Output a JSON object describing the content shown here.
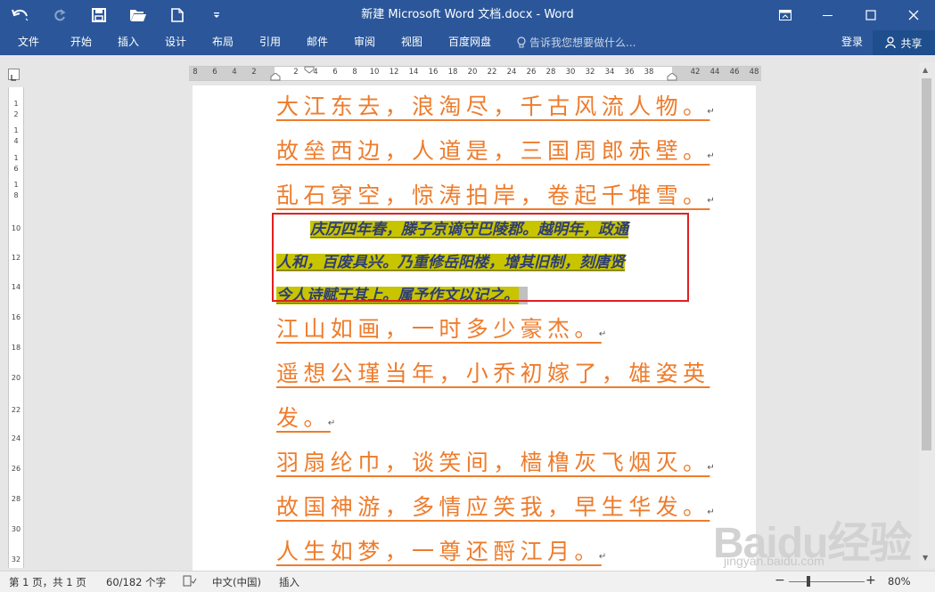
{
  "window": {
    "title": "新建 Microsoft Word 文档.docx - Word"
  },
  "quick_access": {
    "icons": [
      "undo-icon",
      "redo-icon",
      "save-icon",
      "open-icon",
      "new-icon",
      "customize-icon"
    ]
  },
  "ribbon": {
    "tabs": [
      "文件",
      "开始",
      "插入",
      "设计",
      "布局",
      "引用",
      "邮件",
      "审阅",
      "视图",
      "百度网盘"
    ],
    "tell_me": "告诉我您想要做什么...",
    "sign_in": "登录",
    "share": "共享"
  },
  "ruler": {
    "h_numbers": [
      "8",
      "6",
      "4",
      "2",
      "2",
      "4",
      "6",
      "8",
      "10",
      "12",
      "14",
      "16",
      "18",
      "20",
      "22",
      "24",
      "26",
      "28",
      "30",
      "32",
      "34",
      "36",
      "38",
      "42",
      "44",
      "46",
      "48"
    ],
    "v_numbers": [
      "1",
      "2",
      "1",
      "4",
      "1",
      "6",
      "1",
      "8",
      "10",
      "12",
      "14",
      "16",
      "18",
      "20",
      "22",
      "24",
      "26",
      "28",
      "30",
      "32"
    ]
  },
  "document": {
    "lines_before": [
      "大江东去，浪淘尽，千古风流人物。",
      "故垒西边，人道是，三国周郎赤壁。",
      "乱石穿空，惊涛拍岸，卷起千堆雪。"
    ],
    "selected_paragraph": [
      "庆历四年春，滕子京谪守巴陵郡。越明年，政通",
      "人和，百废具兴。乃重修岳阳楼，增其旧制，刻唐贤",
      "今人诗赋于其上。属予作文以记之。"
    ],
    "lines_after": [
      "江山如画，一时多少豪杰。",
      "遥想公瑾当年，小乔初嫁了，雄姿英",
      "发。",
      "羽扇纶巾，谈笑间，樯橹灰飞烟灭。",
      "故国神游，多情应笑我，早生华发。",
      "人生如梦，一尊还酹江月。"
    ],
    "paragraph_mark": "↵",
    "colors": {
      "poem_text": "#ee7c2c",
      "selection_text": "#2e3d74",
      "highlight": "#c8c400",
      "red_box": "#e02020",
      "title_bar": "#2b579a"
    }
  },
  "status_bar": {
    "page": "第 1 页，共 1 页",
    "words": "60/182 个字",
    "language": "中文(中国)",
    "mode": "插入",
    "zoom": "80%"
  },
  "watermark": {
    "main": "Baidu经验",
    "sub": "jingyan.baidu.com"
  }
}
